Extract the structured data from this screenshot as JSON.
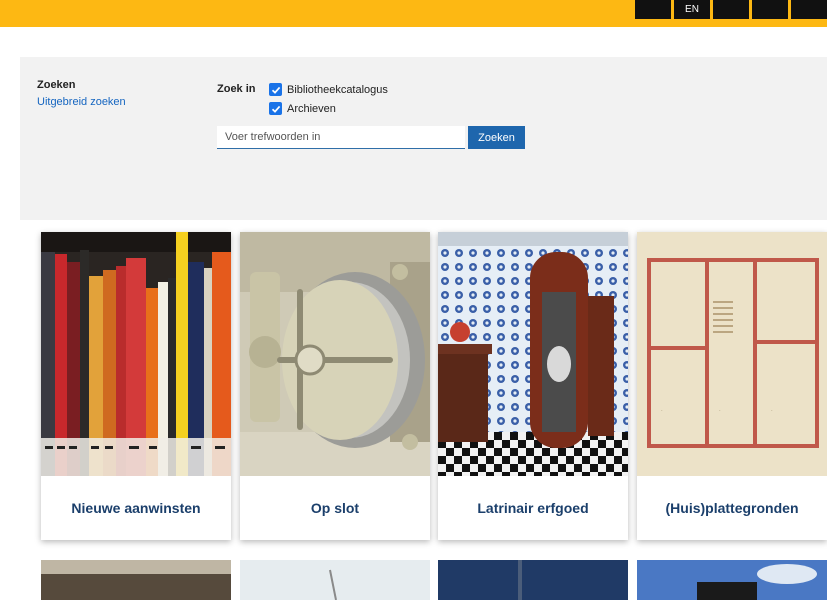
{
  "header": {
    "buttons": [
      "",
      "EN",
      "",
      "",
      ""
    ]
  },
  "search": {
    "title": "Zoeken",
    "advanced_link": "Uitgebreid zoeken",
    "scope_label": "Zoek in",
    "options": [
      {
        "label": "Bibliotheekcatalogus",
        "checked": true
      },
      {
        "label": "Archieven",
        "checked": true
      }
    ],
    "placeholder": "Voer trefwoorden in",
    "button_label": "Zoeken"
  },
  "cards": [
    {
      "title": "Nieuwe aanwinsten",
      "image": "bookshelf-photo"
    },
    {
      "title": "Op slot",
      "image": "vault-door-photo"
    },
    {
      "title": "Latrinair erfgoed",
      "image": "tiled-urinal-photo"
    },
    {
      "title": "(Huis)plattegronden",
      "image": "floor-plan-drawing"
    }
  ],
  "colors": {
    "brand_yellow": "#fdb813",
    "link_blue": "#1565c0",
    "button_blue": "#1e66ad",
    "card_title": "#1b3f6b"
  }
}
